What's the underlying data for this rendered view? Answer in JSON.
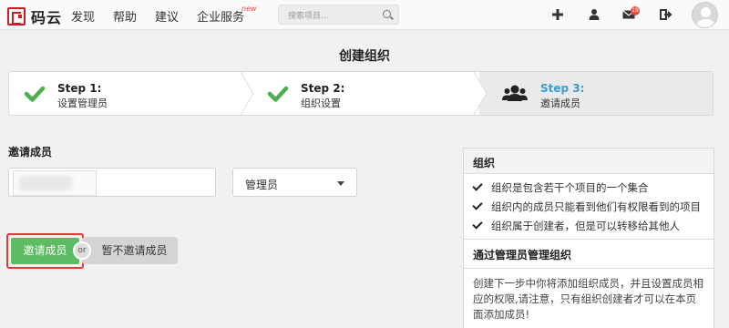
{
  "brand": {
    "name": "码云"
  },
  "nav": {
    "items": [
      "发现",
      "帮助",
      "建议",
      "企业服务"
    ],
    "new_badge": "new"
  },
  "search": {
    "placeholder": "搜索项目..."
  },
  "header_icons": {
    "add": "plus-icon",
    "user": "user-icon",
    "mail": "mail-icon",
    "mail_count": "19",
    "logout": "logout-icon"
  },
  "page": {
    "title": "创建组织"
  },
  "steps": [
    {
      "title": "Step 1:",
      "subtitle": "设置管理员",
      "state": "done"
    },
    {
      "title": "Step 2:",
      "subtitle": "组织设置",
      "state": "done"
    },
    {
      "title": "Step 3:",
      "subtitle": "邀请成员",
      "state": "active"
    }
  ],
  "invite": {
    "label": "邀请成员",
    "role_value": "管理员",
    "submit_label": "邀请成员",
    "or_label": "or",
    "skip_label": "暂不邀请成员"
  },
  "panel": {
    "title": "组织",
    "items": [
      "组织是包含若干个项目的一个集合",
      "组织内的成员只能看到他们有权限看到的项目",
      "组织属于创建者，但是可以转移给其他人"
    ],
    "subtitle": "通过管理员管理组织",
    "description": "创建下一步中你将添加组织成员，并且设置成员相应的权限,请注意，只有组织创建者才可以在本页面添加成员!"
  },
  "colors": {
    "brand": "#c71d23",
    "check": "#4cae4c",
    "active_step": "#3a9bd5",
    "invite_button": "#5dbb63",
    "highlight_border": "#e53935"
  }
}
